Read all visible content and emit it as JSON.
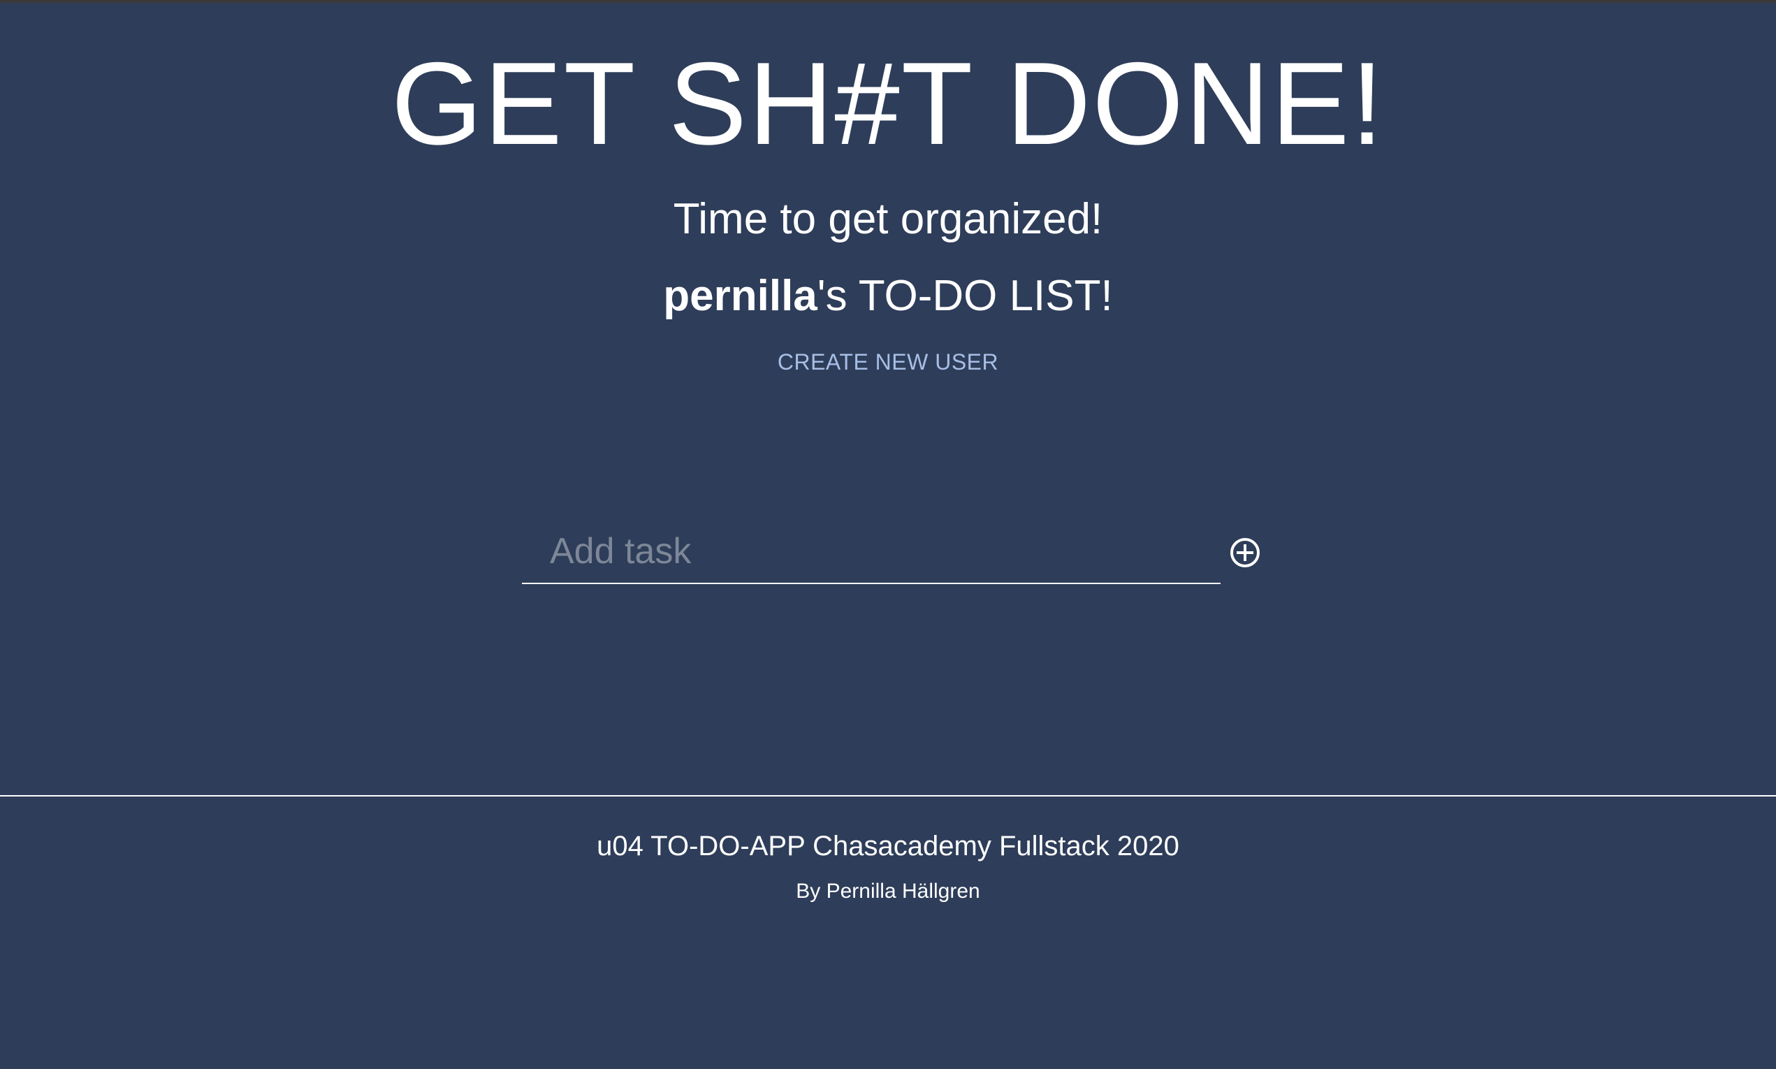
{
  "header": {
    "title": "GET SH#T DONE!",
    "subtitle": "Time to get organized!",
    "owner_name": "pernilla",
    "owner_suffix": "'s TO-DO LIST!",
    "create_user_link": "CREATE NEW USER"
  },
  "task_form": {
    "input_value": "",
    "placeholder": "Add task",
    "add_icon": "plus-circle-icon"
  },
  "footer": {
    "line1": "u04 TO-DO-APP Chasacademy Fullstack 2020",
    "line2": "By Pernilla Hällgren"
  },
  "colors": {
    "background": "#2e3d59",
    "text": "#ffffff",
    "link": "#a7bfe6",
    "placeholder": "#7d8798"
  }
}
